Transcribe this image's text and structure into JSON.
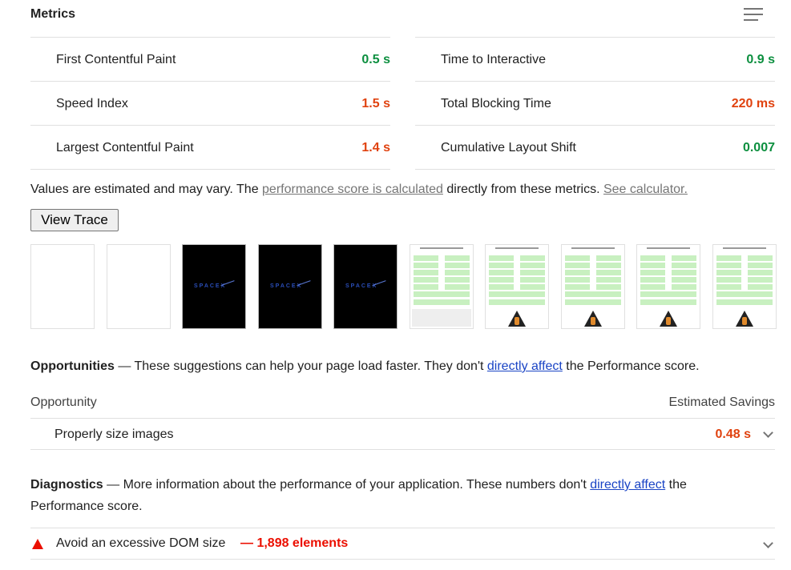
{
  "metrics": {
    "title": "Metrics",
    "left": [
      {
        "label": "First Contentful Paint",
        "value": "0.5 s",
        "status": "good"
      },
      {
        "label": "Speed Index",
        "value": "1.5 s",
        "status": "average"
      },
      {
        "label": "Largest Contentful Paint",
        "value": "1.4 s",
        "status": "average"
      }
    ],
    "right": [
      {
        "label": "Time to Interactive",
        "value": "0.9 s",
        "status": "good"
      },
      {
        "label": "Total Blocking Time",
        "value": "220 ms",
        "status": "average"
      },
      {
        "label": "Cumulative Layout Shift",
        "value": "0.007",
        "status": "good"
      }
    ],
    "colors": {
      "good": "#0c8f3f",
      "average": "#e0420f",
      "fail": "#eb0f00",
      "link": "#1a44c5"
    }
  },
  "note": {
    "prefix": "Values are estimated and may vary. The ",
    "link1": "performance score is calculated",
    "middle": " directly from these metrics.",
    "link2": "See calculator."
  },
  "view_trace_label": "View Trace",
  "filmstrip": {
    "frames": [
      "blank",
      "blank",
      "logo-dark",
      "logo-dark",
      "logo-dark",
      "page",
      "page-rocket",
      "page-rocket",
      "page-rocket",
      "page-rocket"
    ],
    "logo_text": "SPACEX"
  },
  "opportunities": {
    "heading": "Opportunities",
    "dash": " — ",
    "text_before": "These suggestions can help your page load faster. They don't ",
    "link": "directly affect",
    "text_after": " the Performance score.",
    "col_left": "Opportunity",
    "col_right": "Estimated Savings",
    "items": [
      {
        "title": "Properly size images",
        "savings": "0.48 s"
      }
    ]
  },
  "diagnostics": {
    "heading": "Diagnostics",
    "dash": " — ",
    "text_before": "More information about the performance of your application. These numbers don't ",
    "link": "directly affect",
    "text_after": " the Performance score.",
    "items": [
      {
        "title": "Avoid an excessive DOM size",
        "value": "— 1,898 elements"
      }
    ]
  }
}
